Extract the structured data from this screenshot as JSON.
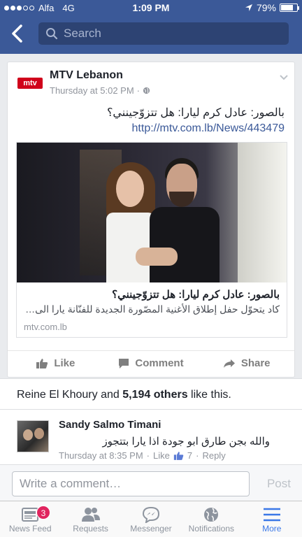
{
  "status_bar": {
    "carrier": "Alfa",
    "network": "4G",
    "time": "1:09 PM",
    "battery": "79%",
    "battery_level": 0.79
  },
  "header": {
    "search_placeholder": "Search"
  },
  "post": {
    "page_name": "MTV Lebanon",
    "logo_text": "mtv",
    "timestamp": "Thursday at 5:02 PM",
    "time_separator": "·",
    "text": "بالصور: عادل كرم ليارا: هل تتزوّجينني؟",
    "link": "http://mtv.com.lb/News/443479",
    "share": {
      "title": "بالصور: عادل كرم ليارا: هل تتزوّجينني؟",
      "description": "كاد يتحوّل حفل إطلاق الأغنية المصّورة الجديدة للفنّانة يارا الى…",
      "domain": "mtv.com.lb"
    },
    "actions": {
      "like": "Like",
      "comment": "Comment",
      "share": "Share"
    }
  },
  "likes": {
    "name": "Reine El Khoury",
    "connector": " and ",
    "others": "5,194 others",
    "suffix": " like this."
  },
  "comment": {
    "author": "Sandy Salmo Timani",
    "text": "والله بجن طارق ابو جودة اذا يارا بتتجوز",
    "time": "Thursday at 8:35 PM",
    "separator": "·",
    "like": "Like",
    "like_count": "7",
    "reply": "Reply"
  },
  "composer": {
    "placeholder": "Write a comment…",
    "post": "Post"
  },
  "tabs": [
    {
      "label": "News Feed",
      "icon": "news-feed-icon",
      "badge": "3"
    },
    {
      "label": "Requests",
      "icon": "requests-icon"
    },
    {
      "label": "Messenger",
      "icon": "messenger-icon"
    },
    {
      "label": "Notifications",
      "icon": "notifications-globe-icon"
    },
    {
      "label": "More",
      "icon": "menu-icon"
    }
  ],
  "colors": {
    "brand": "#3b5998",
    "link": "#3b5998",
    "active_tab": "#3b78e7",
    "badge": "#e0245e",
    "logo": "#d0021b"
  }
}
